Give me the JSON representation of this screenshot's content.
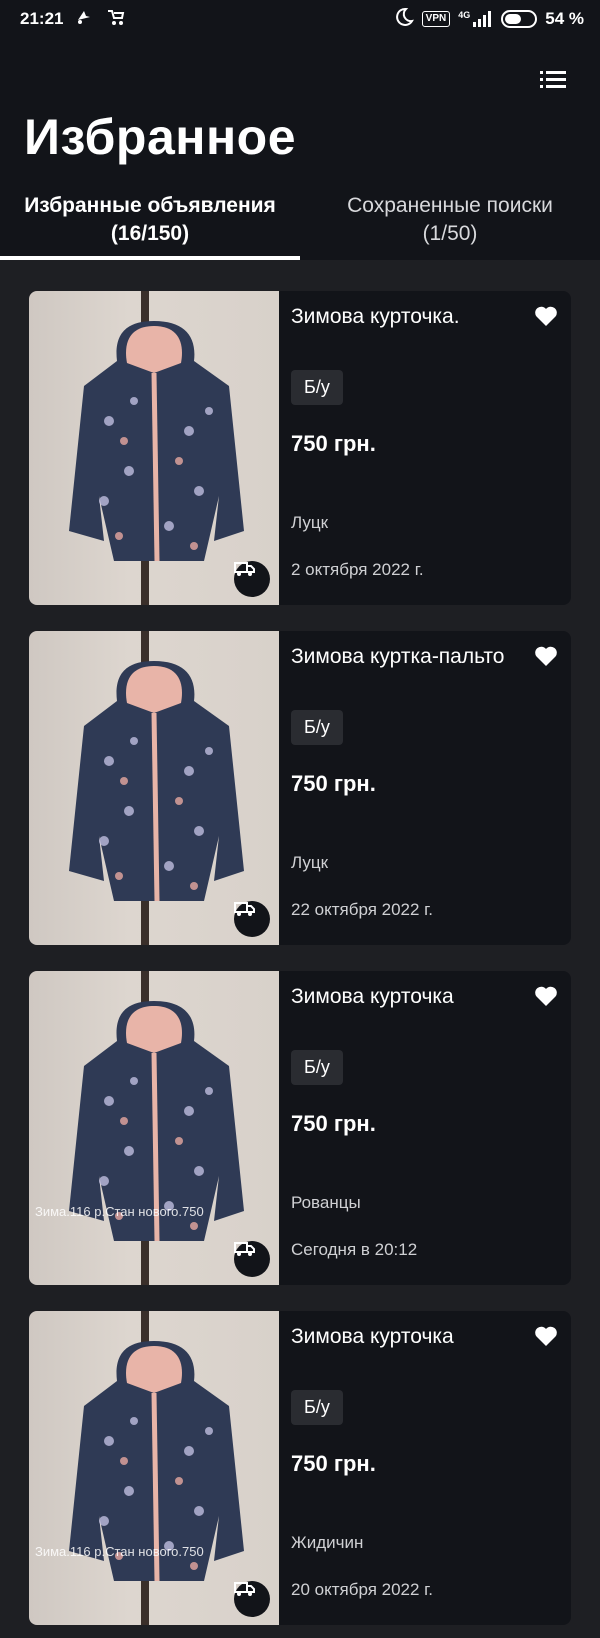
{
  "status_bar": {
    "time": "21:21",
    "vpn": "VPN",
    "network": "4G",
    "battery": "54 %",
    "icons": [
      "notification-icon",
      "stroller-icon",
      "moon-icon",
      "vpn-icon",
      "signal-icon",
      "battery-icon"
    ]
  },
  "header": {
    "title": "Избранное",
    "menu_icon": "list-menu-icon"
  },
  "tabs": [
    {
      "label": "Избранные объявления",
      "count": "(16/150)",
      "active": true
    },
    {
      "label": "Сохраненные поиски",
      "count": "(1/50)",
      "active": false
    }
  ],
  "listings": [
    {
      "title": "Зимова курточка.",
      "condition": "Б/у",
      "price": "750 грн.",
      "location": "Луцк",
      "date": "2 октября 2022 г.",
      "photo_caption": "",
      "favorite": true,
      "delivery": true
    },
    {
      "title": "Зимова куртка-пальто",
      "condition": "Б/у",
      "price": "750 грн.",
      "location": "Луцк",
      "date": "22 октября 2022 г.",
      "photo_caption": "",
      "favorite": true,
      "delivery": true
    },
    {
      "title": "Зимова курточка",
      "condition": "Б/у",
      "price": "750 грн.",
      "location": "Рованцы",
      "date": "Сегодня в 20:12",
      "photo_caption": "Зима.116 р.Стан нового.750",
      "favorite": true,
      "delivery": true
    },
    {
      "title": "Зимова курточка",
      "condition": "Б/у",
      "price": "750 грн.",
      "location": "Жидичин",
      "date": "20 октября 2022 г.",
      "photo_caption": "Зима.116 р.Стан нового.750",
      "favorite": true,
      "delivery": true
    }
  ],
  "colors": {
    "header_bg": "#121419",
    "page_bg": "#1e1f23",
    "card_bg": "#121419",
    "chip_bg": "#2a2c31",
    "jacket": "#2f3a55",
    "jacket_lining": "#e8b4a8"
  }
}
